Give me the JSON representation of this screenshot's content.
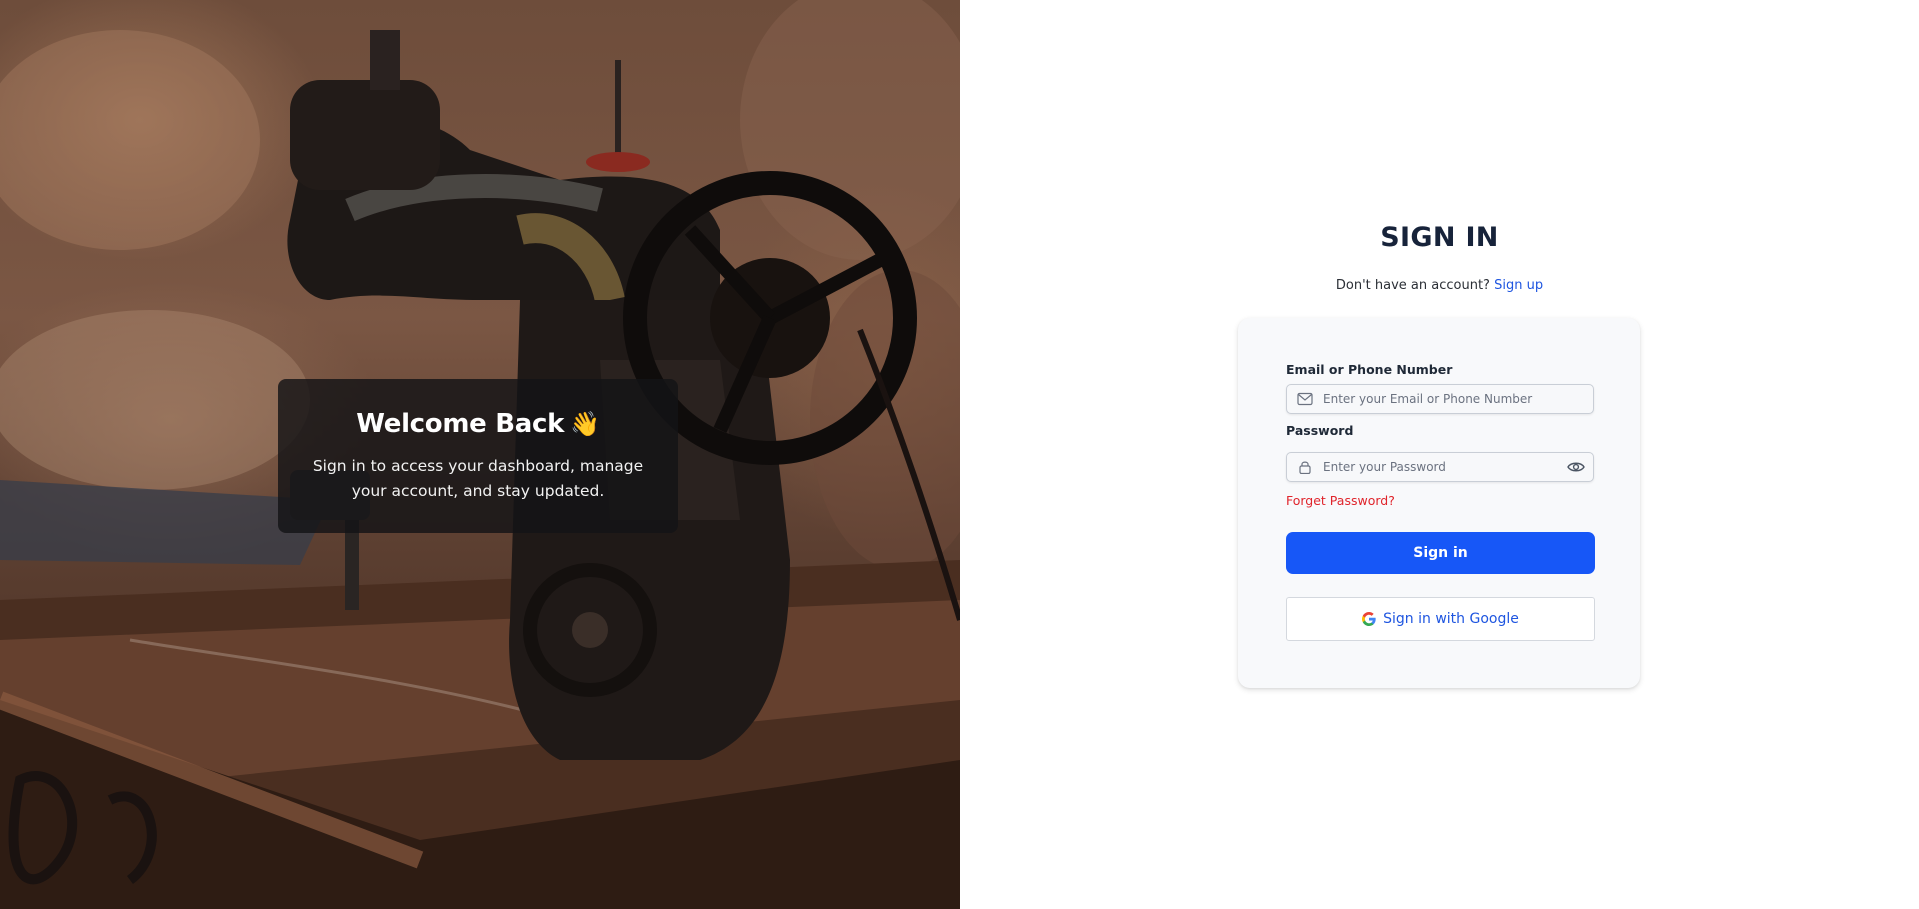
{
  "hero": {
    "welcome_title": "Welcome Back",
    "welcome_emoji": "👋",
    "welcome_text": "Sign in to access your dashboard, manage your account, and stay updated.",
    "image_subject": "vintage sewing machine"
  },
  "form": {
    "title": "SIGN IN",
    "no_account_text": "Don't have an account?",
    "signup_link": "Sign up",
    "email": {
      "label": "Email or Phone Number",
      "placeholder": "Enter your Email or Phone Number",
      "value": "",
      "icon": "mail-icon"
    },
    "password": {
      "label": "Password",
      "placeholder": "Enter your Password",
      "value": "",
      "icon": "lock-icon",
      "toggle_icon": "eye-icon"
    },
    "forgot_password": "Forget Password?",
    "signin_button": "Sign in",
    "google_button": "Sign in with Google",
    "google_icon": "google-icon"
  },
  "colors": {
    "primary": "#1757f7",
    "link": "#1e55e0",
    "danger": "#e0242b",
    "title": "#17233a",
    "card_bg": "#f8f9fb"
  }
}
